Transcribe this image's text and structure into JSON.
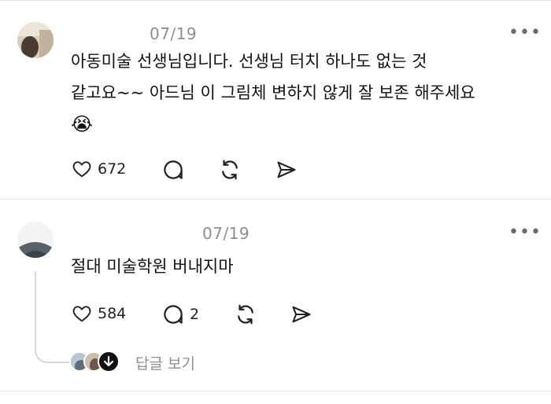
{
  "posts": [
    {
      "date": "07/19",
      "text_lines": [
        "아동미술 선생님입니다. 선생님 터치 하나도 없는 것",
        "같고요~~ 아드님 이 그림체 변하지 않게 잘 보존 해주세요"
      ],
      "emoji": "😭",
      "likes": "672",
      "comments": ""
    },
    {
      "date": "07/19",
      "text_lines": [
        "절대 미술학원 버내지마"
      ],
      "likes": "584",
      "comments": "2",
      "replies_label": "답글 보기"
    }
  ],
  "icons": {
    "like": "heart-icon",
    "comment": "comment-bubble-icon",
    "repost": "repost-icon",
    "share": "send-icon",
    "more": "more-dots-icon",
    "expand": "arrow-down-icon"
  },
  "colors": {
    "text": "#111111",
    "muted": "#8e8e8e",
    "icon": "#222222",
    "divider": "#e6e6e6"
  }
}
